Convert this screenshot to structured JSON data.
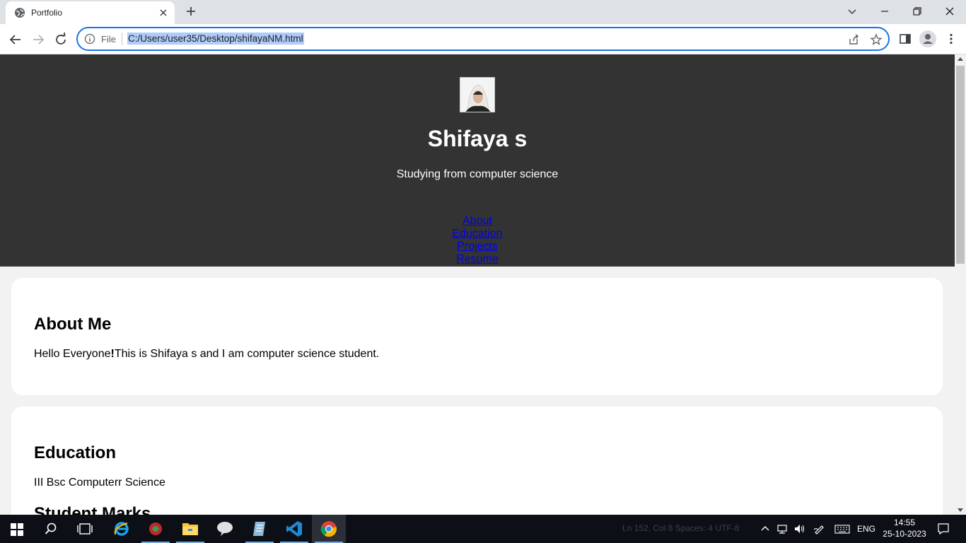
{
  "browser": {
    "tab_title": "Portfolio",
    "url_scheme": "File",
    "url": "C:/Users/user35/Desktop/shifayaNM.html"
  },
  "page": {
    "name": "Shifaya s",
    "tagline": "Studying from computer science",
    "nav": [
      "About",
      "Education",
      "Projects",
      "Resume"
    ],
    "about": {
      "heading": "About Me",
      "text_prefix": "Hello Everyone",
      "text_bang": "!",
      "text_suffix": "This is Shifaya s and I am computer science student."
    },
    "education": {
      "heading": "Education",
      "degree": "III Bsc Computerr Science",
      "marks_heading": "Student Marks"
    }
  },
  "taskbar": {
    "status_ghost": "Ln 152, Col 8    Spaces: 4    UTF-8",
    "lang": "ENG",
    "time": "14:55",
    "date": "25-10-2023"
  },
  "colors": {
    "header_bg": "#333333",
    "link": "#0000ee",
    "accent": "#1a73e8",
    "url_highlight": "#aecbfa"
  }
}
